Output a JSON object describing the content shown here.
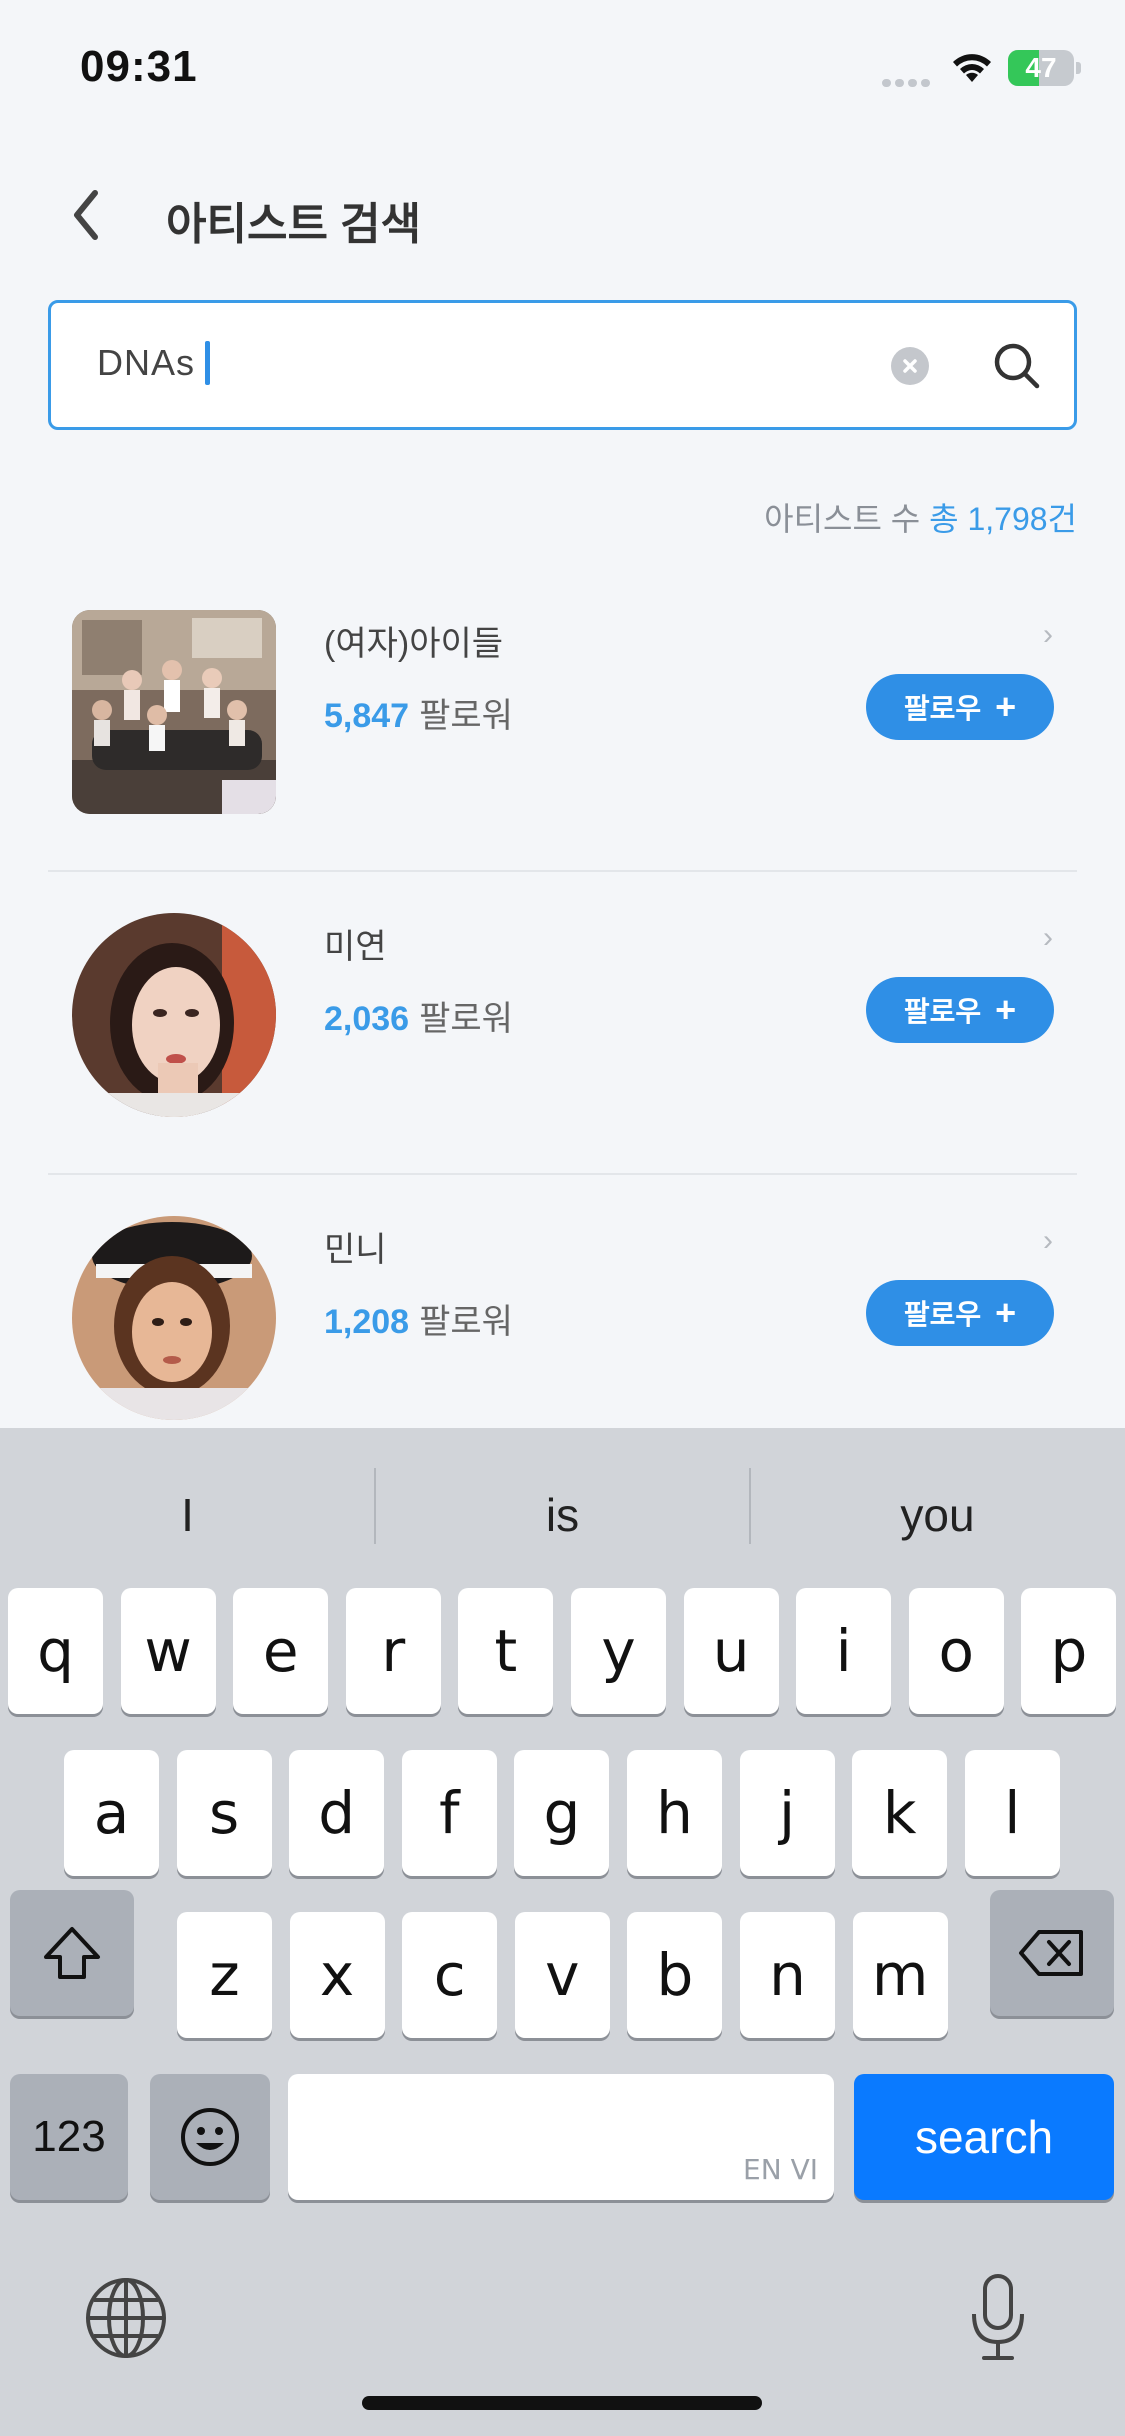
{
  "status_bar": {
    "time": "09:31",
    "battery": "47",
    "battery_level": 0.47
  },
  "header": {
    "title": "아티스트 검색"
  },
  "search": {
    "value": "DNAs"
  },
  "results": {
    "count_label": "아티스트 수",
    "count_value": "총 1,798건"
  },
  "artists": [
    {
      "name": "(여자)아이들",
      "followers": "5,847",
      "followers_label": "팔로워",
      "follow_label": "팔로우"
    },
    {
      "name": "미연",
      "followers": "2,036",
      "followers_label": "팔로워",
      "follow_label": "팔로우"
    },
    {
      "name": "민니",
      "followers": "1,208",
      "followers_label": "팔로워",
      "follow_label": "팔로우"
    }
  ],
  "keyboard": {
    "suggestions": [
      "I",
      "is",
      "you"
    ],
    "row1": [
      "q",
      "w",
      "e",
      "r",
      "t",
      "y",
      "u",
      "i",
      "o",
      "p"
    ],
    "row2": [
      "a",
      "s",
      "d",
      "f",
      "g",
      "h",
      "j",
      "k",
      "l"
    ],
    "row3": [
      "z",
      "x",
      "c",
      "v",
      "b",
      "n",
      "m"
    ],
    "numbers_key": "123",
    "space_language": "EN VI",
    "search_key": "search"
  },
  "colors": {
    "accent": "#3a9be8",
    "follow_button": "#2f8fe6",
    "keyboard_bg": "#d1d4d9",
    "search_key": "#0a7aff"
  }
}
